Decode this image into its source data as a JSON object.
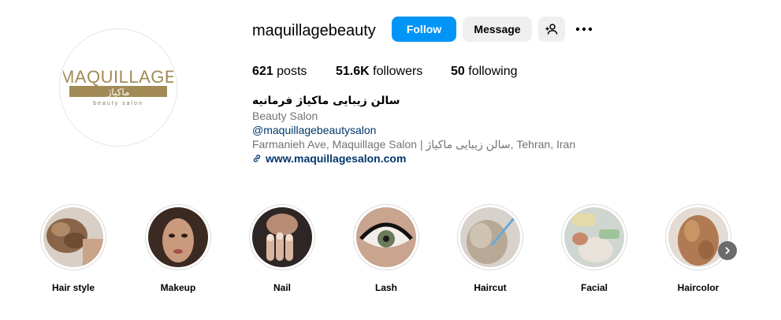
{
  "profile": {
    "username": "maquillagebeauty",
    "logo": {
      "word": "MAQUILLAGE",
      "arabic": "ماکیاژ",
      "sub": "beauty salon"
    },
    "follow_label": "Follow",
    "message_label": "Message",
    "add_user_icon": "person-add-icon",
    "more_icon": "more-horizontal-icon"
  },
  "stats": {
    "posts_count": "621",
    "posts_label": "posts",
    "followers_count": "51.6K",
    "followers_label": "followers",
    "following_count": "50",
    "following_label": "following"
  },
  "bio": {
    "full_name": "سالن زیبایی ماکیاژ فرمانیه",
    "category": "Beauty Salon",
    "handle": "@maquillagebeautysalon",
    "address": "Farmanieh Ave, Maquillage Salon | سالن زیبایی ماکیاژ, Tehran, Iran",
    "website": "www.maquillagesalon.com",
    "link_icon": "link-icon"
  },
  "highlights": [
    {
      "label": "Hair style"
    },
    {
      "label": "Makeup"
    },
    {
      "label": "Nail"
    },
    {
      "label": "Lash"
    },
    {
      "label": "Haircut"
    },
    {
      "label": "Facial"
    },
    {
      "label": "Haircolor"
    }
  ],
  "colors": {
    "follow_blue": "#0095f6",
    "link_blue": "#00376b",
    "muted": "#737373",
    "logo_gold": "#a18a55"
  }
}
